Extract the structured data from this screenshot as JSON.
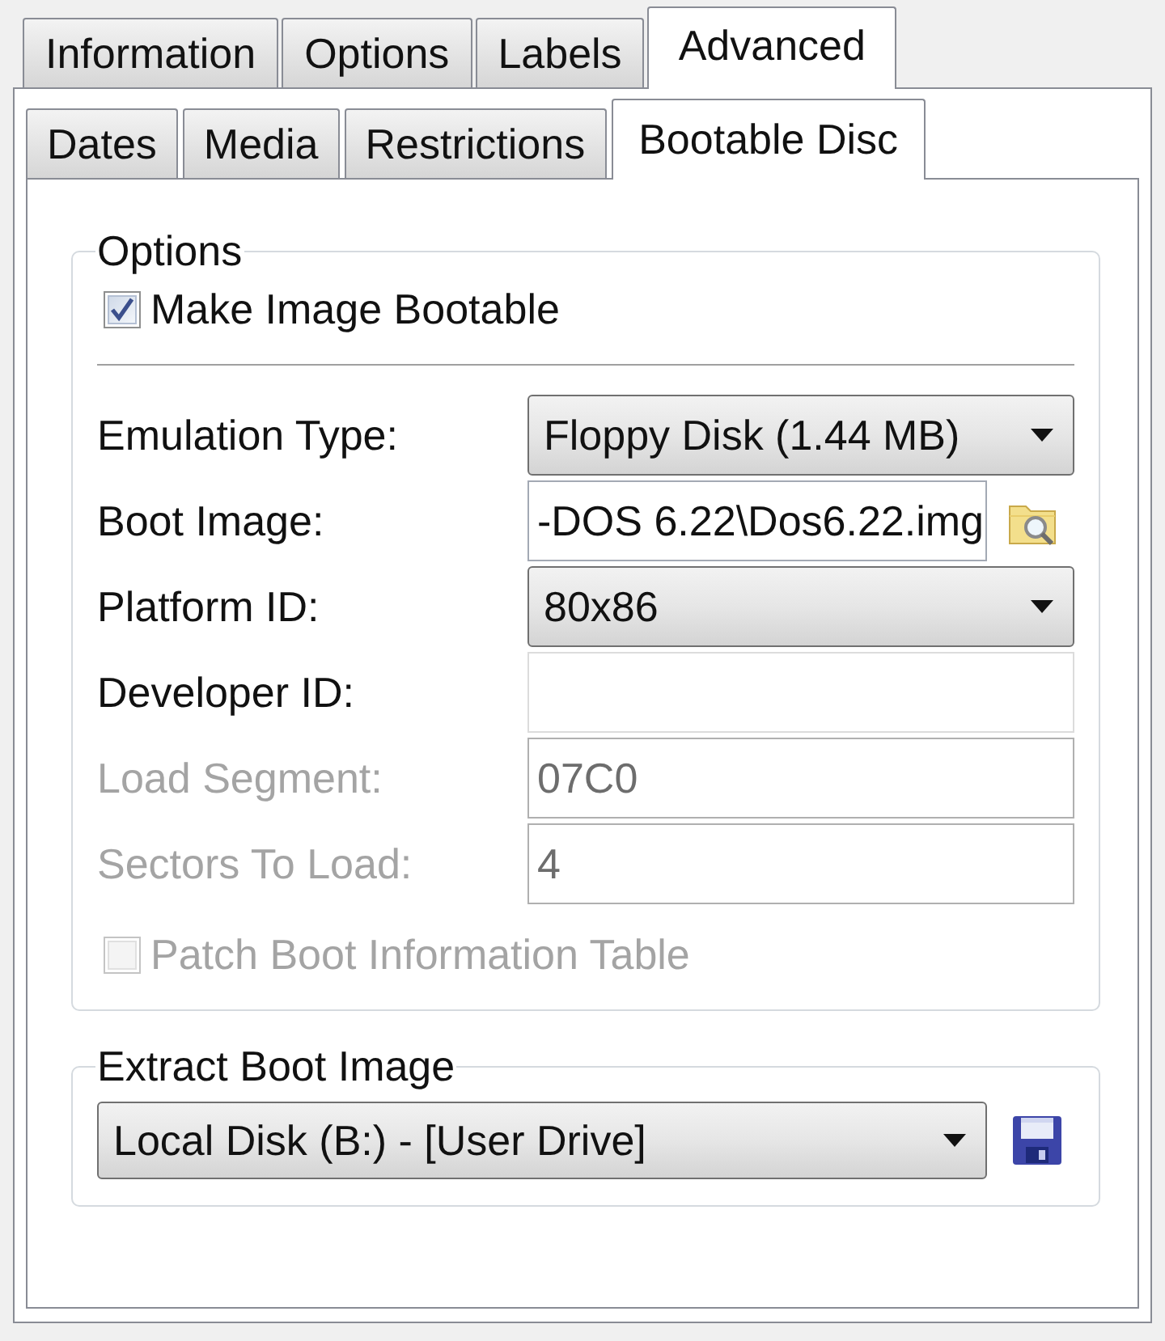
{
  "outer_tabs": [
    {
      "label": "Information",
      "selected": false
    },
    {
      "label": "Options",
      "selected": false
    },
    {
      "label": "Labels",
      "selected": false
    },
    {
      "label": "Advanced",
      "selected": true
    }
  ],
  "inner_tabs": [
    {
      "label": "Dates",
      "selected": false
    },
    {
      "label": "Media",
      "selected": false
    },
    {
      "label": "Restrictions",
      "selected": false
    },
    {
      "label": "Bootable Disc",
      "selected": true
    }
  ],
  "options_group": {
    "title": "Options",
    "make_bootable": {
      "label": "Make Image Bootable",
      "checked": true,
      "disabled": false
    },
    "fields": [
      {
        "kind": "dropdown",
        "label": "Emulation Type:",
        "value": "Floppy Disk (1.44 MB)",
        "disabled": false
      },
      {
        "kind": "file",
        "label": "Boot Image:",
        "value": "-DOS 6.22\\Dos6.22.img",
        "disabled": false
      },
      {
        "kind": "dropdown",
        "label": "Platform ID:",
        "value": "80x86",
        "disabled": false
      },
      {
        "kind": "text",
        "label": "Developer ID:",
        "disabled": false
      },
      {
        "kind": "text",
        "label": "Load Segment:",
        "value": "07C0",
        "disabled": true
      },
      {
        "kind": "text",
        "label": "Sectors To Load:",
        "value": "4",
        "disabled": true
      }
    ],
    "patch_boot_table": {
      "label": "Patch Boot Information Table",
      "checked": false,
      "disabled": true
    }
  },
  "extract_group": {
    "title": "Extract Boot Image",
    "drive": {
      "value": "Local Disk (B:) - [User Drive]"
    }
  }
}
